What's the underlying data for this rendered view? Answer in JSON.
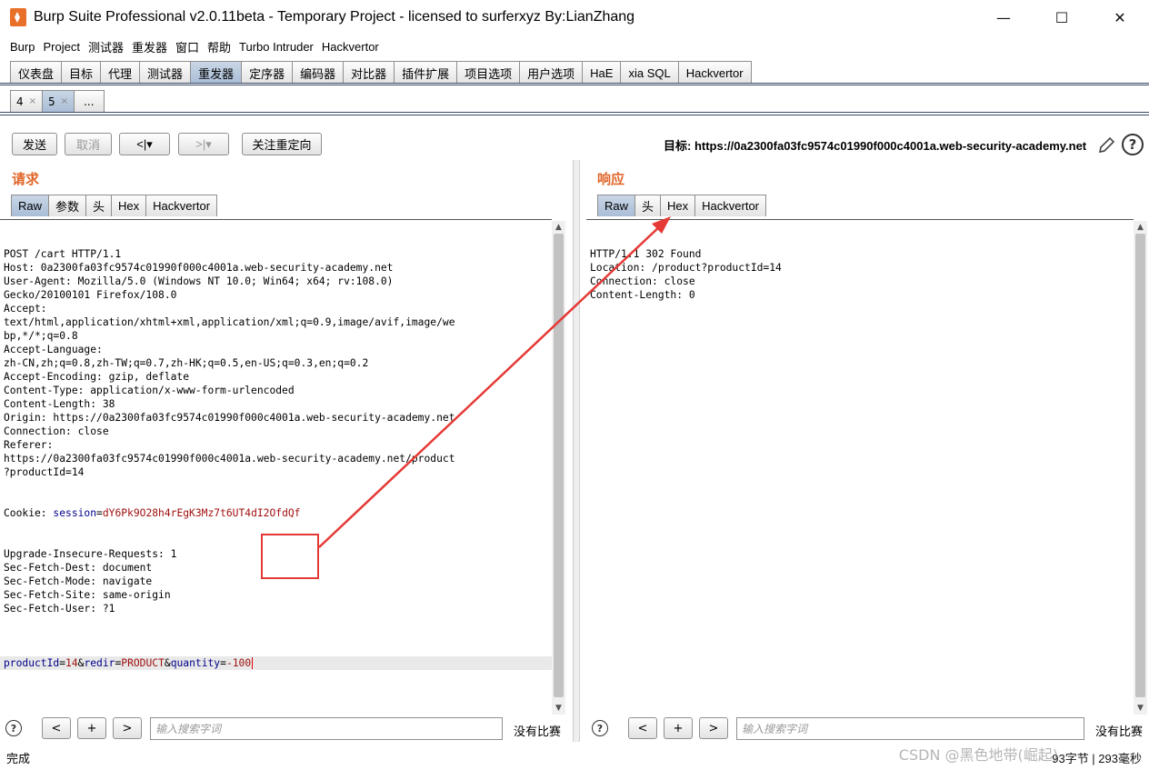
{
  "window": {
    "title": "Burp Suite Professional v2.0.11beta - Temporary Project - licensed to surferxyz By:LianZhang",
    "minimize": "—",
    "maximize": "☐",
    "close": "✕"
  },
  "menu": [
    "Burp",
    "Project",
    "测试器",
    "重发器",
    "窗口",
    "帮助",
    "Turbo Intruder",
    "Hackvertor"
  ],
  "main_tabs": [
    "仪表盘",
    "目标",
    "代理",
    "测试器",
    "重发器",
    "定序器",
    "编码器",
    "对比器",
    "插件扩展",
    "项目选项",
    "用户选项",
    "HaE",
    "xia SQL",
    "Hackvertor"
  ],
  "active_main_tab": "重发器",
  "sub_tabs": [
    {
      "label": "4",
      "close": "×"
    },
    {
      "label": "5",
      "close": "×"
    },
    {
      "label": "...",
      "close": ""
    }
  ],
  "toolbar": {
    "send": "发送",
    "cancel": "取消",
    "back": "<|▾",
    "forward": ">|▾",
    "follow_redirect": "关注重定向",
    "target_label": "目标: https://0a2300fa03fc9574c01990f000c4001a.web-security-academy.net"
  },
  "request": {
    "title": "请求",
    "tabs": [
      "Raw",
      "参数",
      "头",
      "Hex",
      "Hackvertor"
    ],
    "lines": [
      "POST /cart HTTP/1.1",
      "Host: 0a2300fa03fc9574c01990f000c4001a.web-security-academy.net",
      "User-Agent: Mozilla/5.0 (Windows NT 10.0; Win64; x64; rv:108.0)",
      "Gecko/20100101 Firefox/108.0",
      "Accept:",
      "text/html,application/xhtml+xml,application/xml;q=0.9,image/avif,image/we",
      "bp,*/*;q=0.8",
      "Accept-Language:",
      "zh-CN,zh;q=0.8,zh-TW;q=0.7,zh-HK;q=0.5,en-US;q=0.3,en;q=0.2",
      "Accept-Encoding: gzip, deflate",
      "Content-Type: application/x-www-form-urlencoded",
      "Content-Length: 38",
      "Origin: https://0a2300fa03fc9574c01990f000c4001a.web-security-academy.net",
      "Connection: close",
      "Referer:",
      "https://0a2300fa03fc9574c01990f000c4001a.web-security-academy.net/product",
      "?productId=14"
    ],
    "cookie_prefix": "Cookie: ",
    "cookie_name": "session",
    "cookie_eq": "=",
    "cookie_value": "dY6Pk9O28h4rEgK3Mz7t6UT4dI2OfdQf",
    "lines_after": [
      "Upgrade-Insecure-Requests: 1",
      "Sec-Fetch-Dest: document",
      "Sec-Fetch-Mode: navigate",
      "Sec-Fetch-Site: same-origin",
      "Sec-Fetch-User: ?1",
      ""
    ],
    "body": {
      "k1": "productId",
      "v1": "14",
      "k2": "redir",
      "v2": "PRODUCT",
      "k3": "quantity",
      "v3": "-100"
    },
    "search_placeholder": "输入搜索字词",
    "no_match": "没有比赛"
  },
  "response": {
    "title": "响应",
    "tabs": [
      "Raw",
      "头",
      "Hex",
      "Hackvertor"
    ],
    "lines": [
      "HTTP/1.1 302 Found",
      "Location: /product?productId=14",
      "Connection: close",
      "Content-Length: 0"
    ],
    "search_placeholder": "输入搜索字词",
    "no_match": "没有比赛"
  },
  "search_buttons": [
    "<",
    "+",
    ">"
  ],
  "help_glyph": "?",
  "status": {
    "left": "完成",
    "right": "93字节 | 293毫秒"
  },
  "watermark": "CSDN @黑色地带(崛起)",
  "annotation_color": "#e53935"
}
